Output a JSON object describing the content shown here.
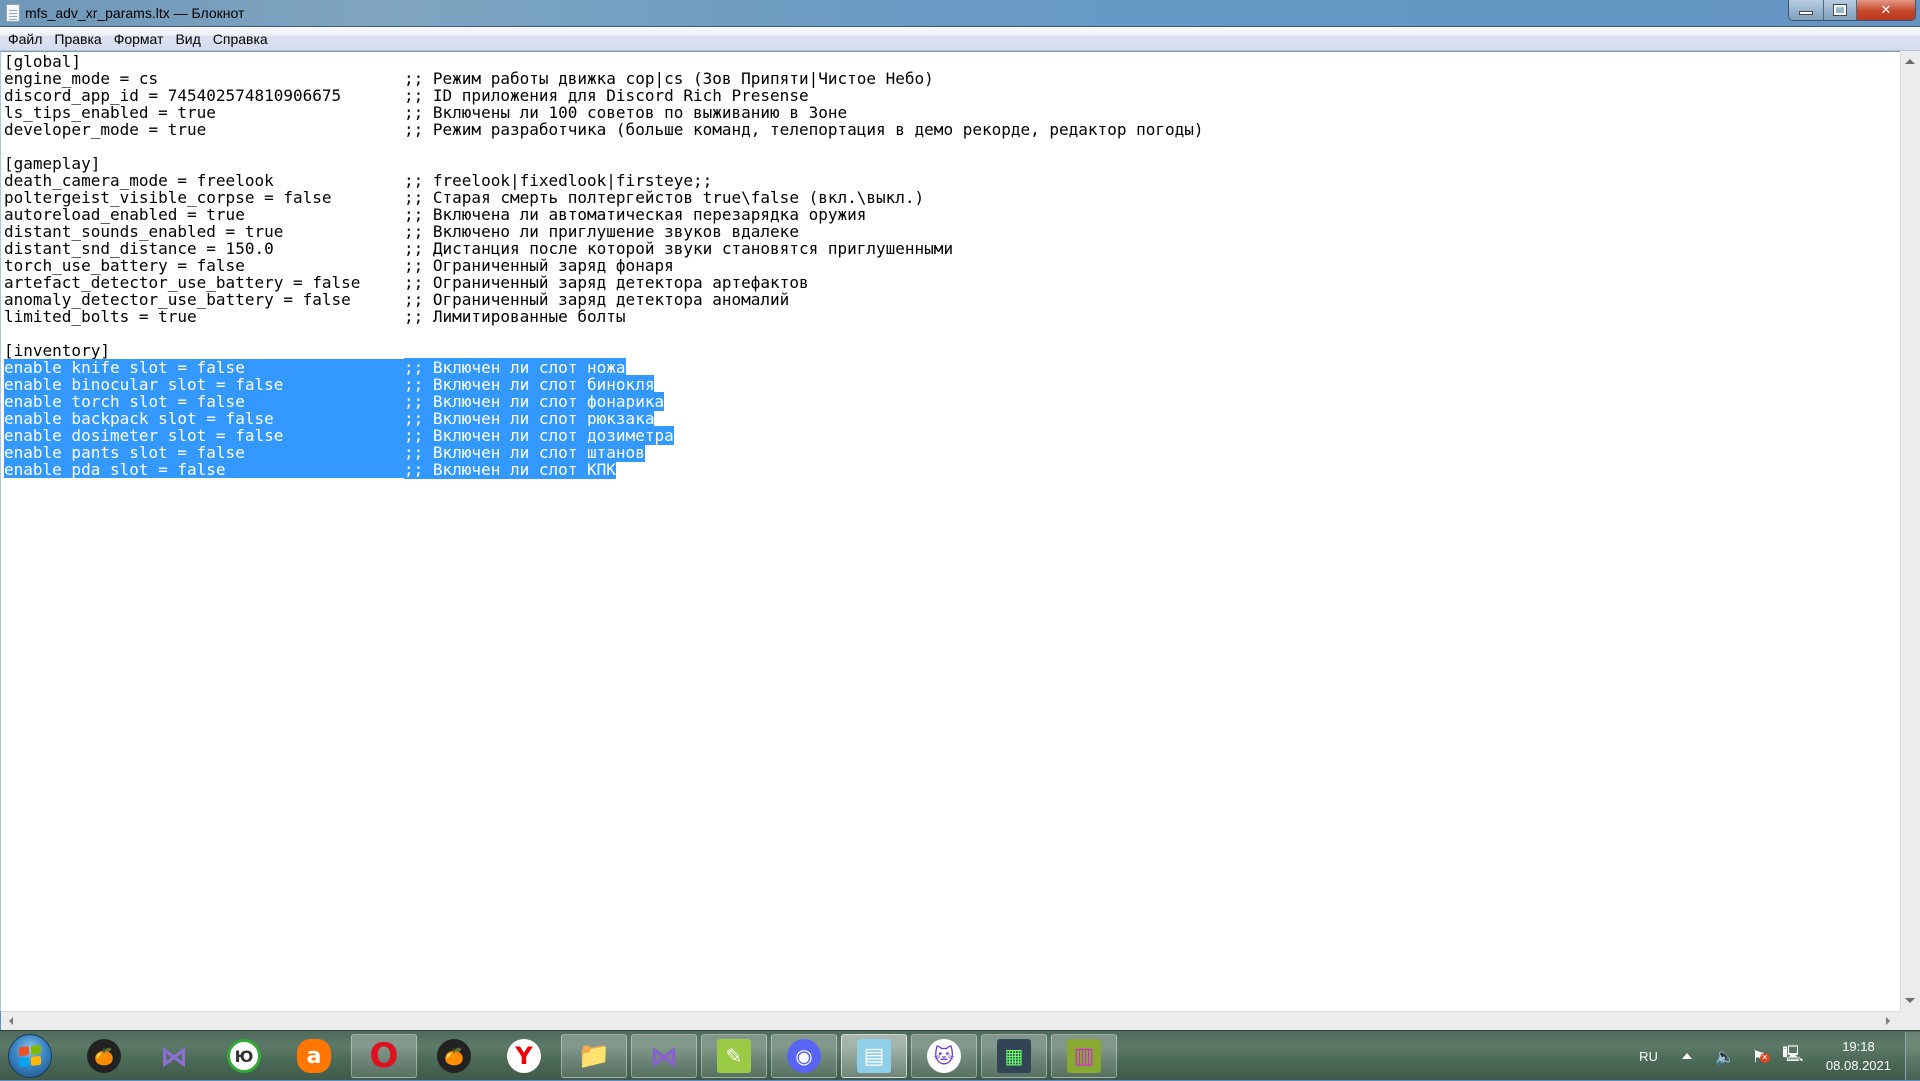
{
  "window": {
    "title": "mfs_adv_xr_params.ltx — Блокнот",
    "controls": {
      "minimize": "minimize",
      "maximize": "restore",
      "close": "close"
    }
  },
  "menu": [
    "Файл",
    "Правка",
    "Формат",
    "Вид",
    "Справка"
  ],
  "editor": {
    "lines": [
      {
        "key": "[global]",
        "comment": "",
        "selected": false
      },
      {
        "key": "engine_mode = cs",
        "comment": ";; Режим работы движка cop|cs (Зов Припяти|Чистое Небо)",
        "selected": false
      },
      {
        "key": "discord_app_id = 745402574810906675",
        "comment": ";; ID приложения для Discord Rich Presense",
        "selected": false
      },
      {
        "key": "ls_tips_enabled = true",
        "comment": ";; Включены ли 100 советов по выживанию в Зоне",
        "selected": false
      },
      {
        "key": "developer_mode = true",
        "comment": ";; Режим разработчика (больше команд, телепортация в демо рекорде, редактор погоды)",
        "selected": false
      },
      {
        "key": "",
        "comment": "",
        "selected": false
      },
      {
        "key": "[gameplay]",
        "comment": "",
        "selected": false
      },
      {
        "key": "death_camera_mode = freelook",
        "comment": ";; freelook|fixedlook|firsteye;;",
        "selected": false
      },
      {
        "key": "poltergeist_visible_corpse = false",
        "comment": ";; Старая смерть полтергейстов true\\false (вкл.\\выкл.)",
        "selected": false
      },
      {
        "key": "autoreload_enabled = true",
        "comment": ";; Включена ли автоматическая перезарядка оружия",
        "selected": false
      },
      {
        "key": "distant_sounds_enabled = true",
        "comment": ";; Включено ли приглушение звуков вдалеке",
        "selected": false
      },
      {
        "key": "distant_snd_distance = 150.0",
        "comment": ";; Дистанция после которой звуки становятся приглушенными",
        "selected": false
      },
      {
        "key": "torch_use_battery = false",
        "comment": ";; Ограниченный заряд фонаря",
        "selected": false
      },
      {
        "key": "artefact_detector_use_battery = false",
        "comment": ";; Ограниченный заряд детектора артефактов",
        "selected": false
      },
      {
        "key": "anomaly_detector_use_battery = false",
        "comment": ";; Ограниченный заряд детектора аномалий",
        "selected": false
      },
      {
        "key": "limited_bolts = true",
        "comment": ";; Лимитированные болты",
        "selected": false
      },
      {
        "key": "",
        "comment": "",
        "selected": false
      },
      {
        "key": "[inventory]",
        "comment": "",
        "selected": false
      },
      {
        "key": "enable_knife_slot = false",
        "comment": ";; Включен ли слот ножа",
        "selected": true
      },
      {
        "key": "enable_binocular_slot = false",
        "comment": ";; Включен ли слот бинокля",
        "selected": true
      },
      {
        "key": "enable_torch_slot = false",
        "comment": ";; Включен ли слот фонарика",
        "selected": true
      },
      {
        "key": "enable_backpack_slot = false",
        "comment": ";; Включен ли слот рюкзака",
        "selected": true
      },
      {
        "key": "enable_dosimeter_slot = false",
        "comment": ";; Включен ли слот дозиметра",
        "selected": true
      },
      {
        "key": "enable_pants_slot = false",
        "comment": ";; Включен ли слот штанов",
        "selected": true
      },
      {
        "key": "enable_pda_slot = false",
        "comment": ";; Включен ли слот КПК",
        "selected": true
      }
    ],
    "selection_color": "#3399ff"
  },
  "taskbar": {
    "start": "start-button",
    "apps": [
      {
        "name": "fl-studio",
        "glyph": "🍊",
        "state": "pinned"
      },
      {
        "name": "kmplayer",
        "glyph": "⋈",
        "state": "pinned"
      },
      {
        "name": "yu-app",
        "glyph": "Ю",
        "state": "pinned"
      },
      {
        "name": "avast",
        "glyph": "a",
        "state": "pinned"
      },
      {
        "name": "opera",
        "glyph": "O",
        "state": "open"
      },
      {
        "name": "fl-studio-2",
        "glyph": "🍊",
        "state": "pinned"
      },
      {
        "name": "yandex-browser",
        "glyph": "Y",
        "state": "pinned"
      },
      {
        "name": "explorer",
        "glyph": "📁",
        "state": "open"
      },
      {
        "name": "visual-studio",
        "glyph": "⋈",
        "state": "open"
      },
      {
        "name": "notepad-plus-plus",
        "glyph": "✎",
        "state": "open"
      },
      {
        "name": "discord",
        "glyph": "◉",
        "state": "open"
      },
      {
        "name": "notepad",
        "glyph": "▤",
        "state": "active"
      },
      {
        "name": "github-desktop",
        "glyph": "🐱",
        "state": "open"
      },
      {
        "name": "task-manager",
        "glyph": "▦",
        "state": "open"
      },
      {
        "name": "winrar",
        "glyph": "▥",
        "state": "open"
      }
    ],
    "tray": {
      "language": "RU",
      "time": "19:18",
      "date": "08.08.2021"
    }
  }
}
